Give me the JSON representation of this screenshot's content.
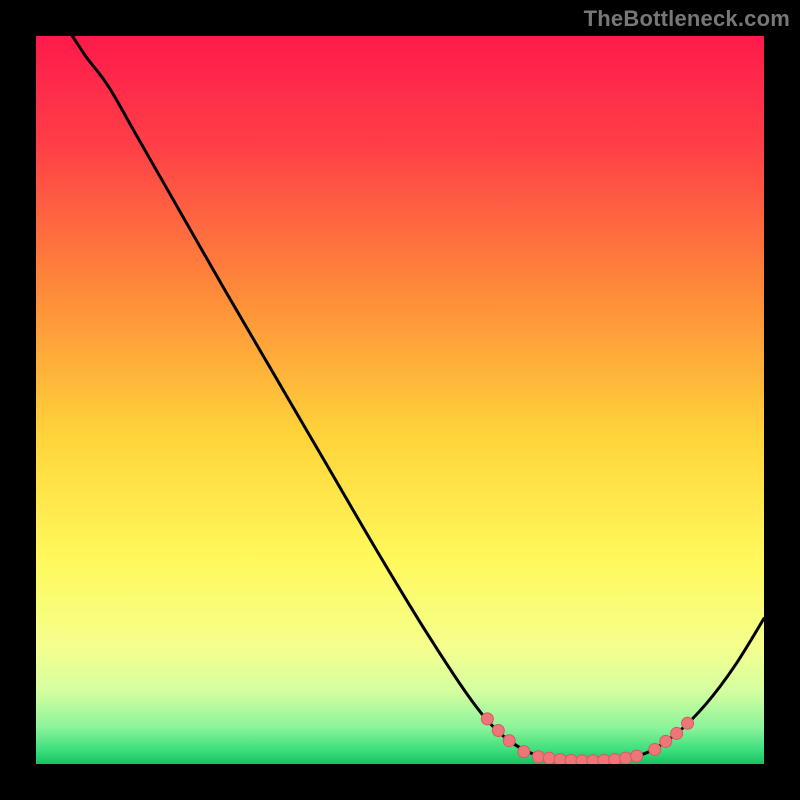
{
  "watermark": "TheBottleneck.com",
  "colors": {
    "background": "#000000",
    "gradient_stops": [
      {
        "offset": 0,
        "color": "#ff1a4b"
      },
      {
        "offset": 0.15,
        "color": "#ff3f47"
      },
      {
        "offset": 0.35,
        "color": "#ff8a3a"
      },
      {
        "offset": 0.55,
        "color": "#ffd43a"
      },
      {
        "offset": 0.72,
        "color": "#fff95c"
      },
      {
        "offset": 0.84,
        "color": "#f4ff8e"
      },
      {
        "offset": 0.9,
        "color": "#d4ffa0"
      },
      {
        "offset": 0.95,
        "color": "#8cf39a"
      },
      {
        "offset": 0.98,
        "color": "#3de07d"
      },
      {
        "offset": 1.0,
        "color": "#17c25e"
      }
    ],
    "curve": "#000000",
    "dot_fill": "#ef7579",
    "dot_stroke": "#d85a62"
  },
  "chart_data": {
    "type": "line",
    "title": "",
    "xlabel": "",
    "ylabel": "",
    "xlim": [
      0,
      100
    ],
    "ylim": [
      0,
      100
    ],
    "curve": [
      {
        "x": 5,
        "y": 100
      },
      {
        "x": 7,
        "y": 97
      },
      {
        "x": 10,
        "y": 93
      },
      {
        "x": 14,
        "y": 86
      },
      {
        "x": 20,
        "y": 75.5
      },
      {
        "x": 26,
        "y": 65
      },
      {
        "x": 33,
        "y": 53
      },
      {
        "x": 40,
        "y": 41
      },
      {
        "x": 47,
        "y": 29
      },
      {
        "x": 54,
        "y": 17.5
      },
      {
        "x": 60,
        "y": 8.5
      },
      {
        "x": 64,
        "y": 4
      },
      {
        "x": 68,
        "y": 1.5
      },
      {
        "x": 72,
        "y": 0.6
      },
      {
        "x": 76,
        "y": 0.4
      },
      {
        "x": 80,
        "y": 0.6
      },
      {
        "x": 84,
        "y": 1.6
      },
      {
        "x": 88,
        "y": 4.2
      },
      {
        "x": 92,
        "y": 8.2
      },
      {
        "x": 96,
        "y": 13.5
      },
      {
        "x": 100,
        "y": 20
      }
    ],
    "dots": [
      {
        "x": 62,
        "y": 6.2
      },
      {
        "x": 63.5,
        "y": 4.6
      },
      {
        "x": 65,
        "y": 3.2
      },
      {
        "x": 67,
        "y": 1.7
      },
      {
        "x": 69,
        "y": 1.0
      },
      {
        "x": 70.5,
        "y": 0.8
      },
      {
        "x": 72,
        "y": 0.6
      },
      {
        "x": 73.5,
        "y": 0.5
      },
      {
        "x": 75,
        "y": 0.45
      },
      {
        "x": 76.5,
        "y": 0.45
      },
      {
        "x": 78,
        "y": 0.5
      },
      {
        "x": 79.5,
        "y": 0.6
      },
      {
        "x": 81,
        "y": 0.8
      },
      {
        "x": 82.5,
        "y": 1.1
      },
      {
        "x": 85,
        "y": 2.0
      },
      {
        "x": 86.5,
        "y": 3.1
      },
      {
        "x": 88,
        "y": 4.2
      },
      {
        "x": 89.5,
        "y": 5.6
      }
    ]
  }
}
